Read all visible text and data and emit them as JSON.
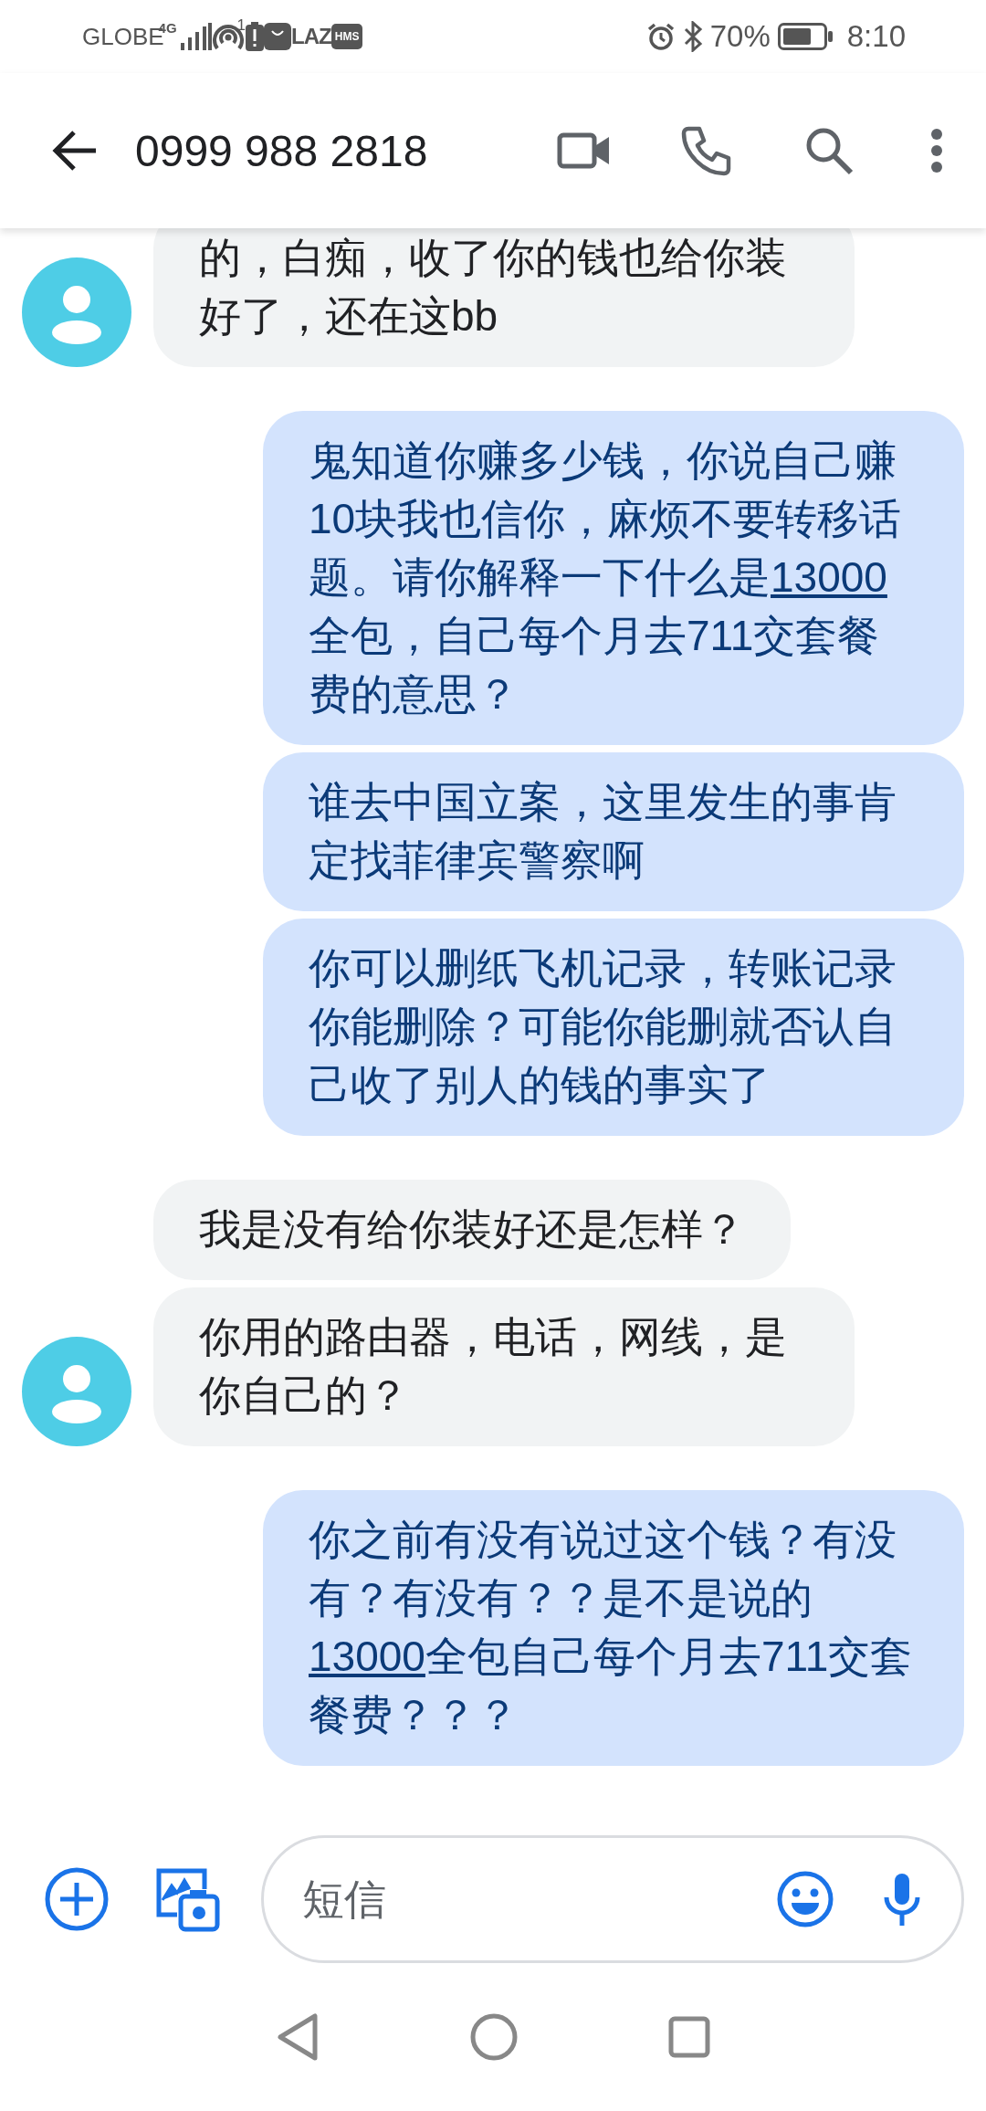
{
  "status_bar": {
    "carrier": "GLOBE",
    "network": "4G",
    "hotspot_count": "1",
    "app_badges": [
      "LAZ",
      "HMS"
    ],
    "battery_percent": "70%",
    "time": "8:10"
  },
  "app_bar": {
    "title": "0999 988 2818"
  },
  "messages": [
    {
      "kind": "incoming",
      "avatar": true,
      "parts": [
        {
          "kind": "text",
          "text": "的，白痴，收了你的钱也给你装好了，还在这bb"
        }
      ]
    },
    {
      "kind": "outgoing",
      "parts": [
        {
          "kind": "text",
          "text": "鬼知道你赚多少钱，你说自己赚10块我也信你，麻烦不要转移话题。请你解释一下什么是"
        },
        {
          "kind": "link",
          "text": "13000"
        },
        {
          "kind": "text",
          "text": "全包，自己每个月去711交套餐费的意思？"
        }
      ]
    },
    {
      "kind": "outgoing",
      "parts": [
        {
          "kind": "text",
          "text": "谁去中国立案，这里发生的事肯定找菲律宾警察啊"
        }
      ]
    },
    {
      "kind": "outgoing",
      "parts": [
        {
          "kind": "text",
          "text": "你可以删纸飞机记录，转账记录你能删除？可能你能删就否认自己收了别人的钱的事实了"
        }
      ]
    },
    {
      "kind": "incoming",
      "avatar": false,
      "parts": [
        {
          "kind": "text",
          "text": "我是没有给你装好还是怎样？"
        }
      ]
    },
    {
      "kind": "incoming",
      "avatar": true,
      "parts": [
        {
          "kind": "text",
          "text": "你用的路由器，电话，网线，是你自己的？"
        }
      ]
    },
    {
      "kind": "outgoing",
      "parts": [
        {
          "kind": "text",
          "text": "你之前有没有说过这个钱？有没有？有没有？？是不是说的"
        },
        {
          "kind": "link",
          "text": "13000"
        },
        {
          "kind": "text",
          "text": "全包自己每个月去711交套餐费？？？"
        }
      ]
    }
  ],
  "composer": {
    "placeholder": "短信"
  }
}
